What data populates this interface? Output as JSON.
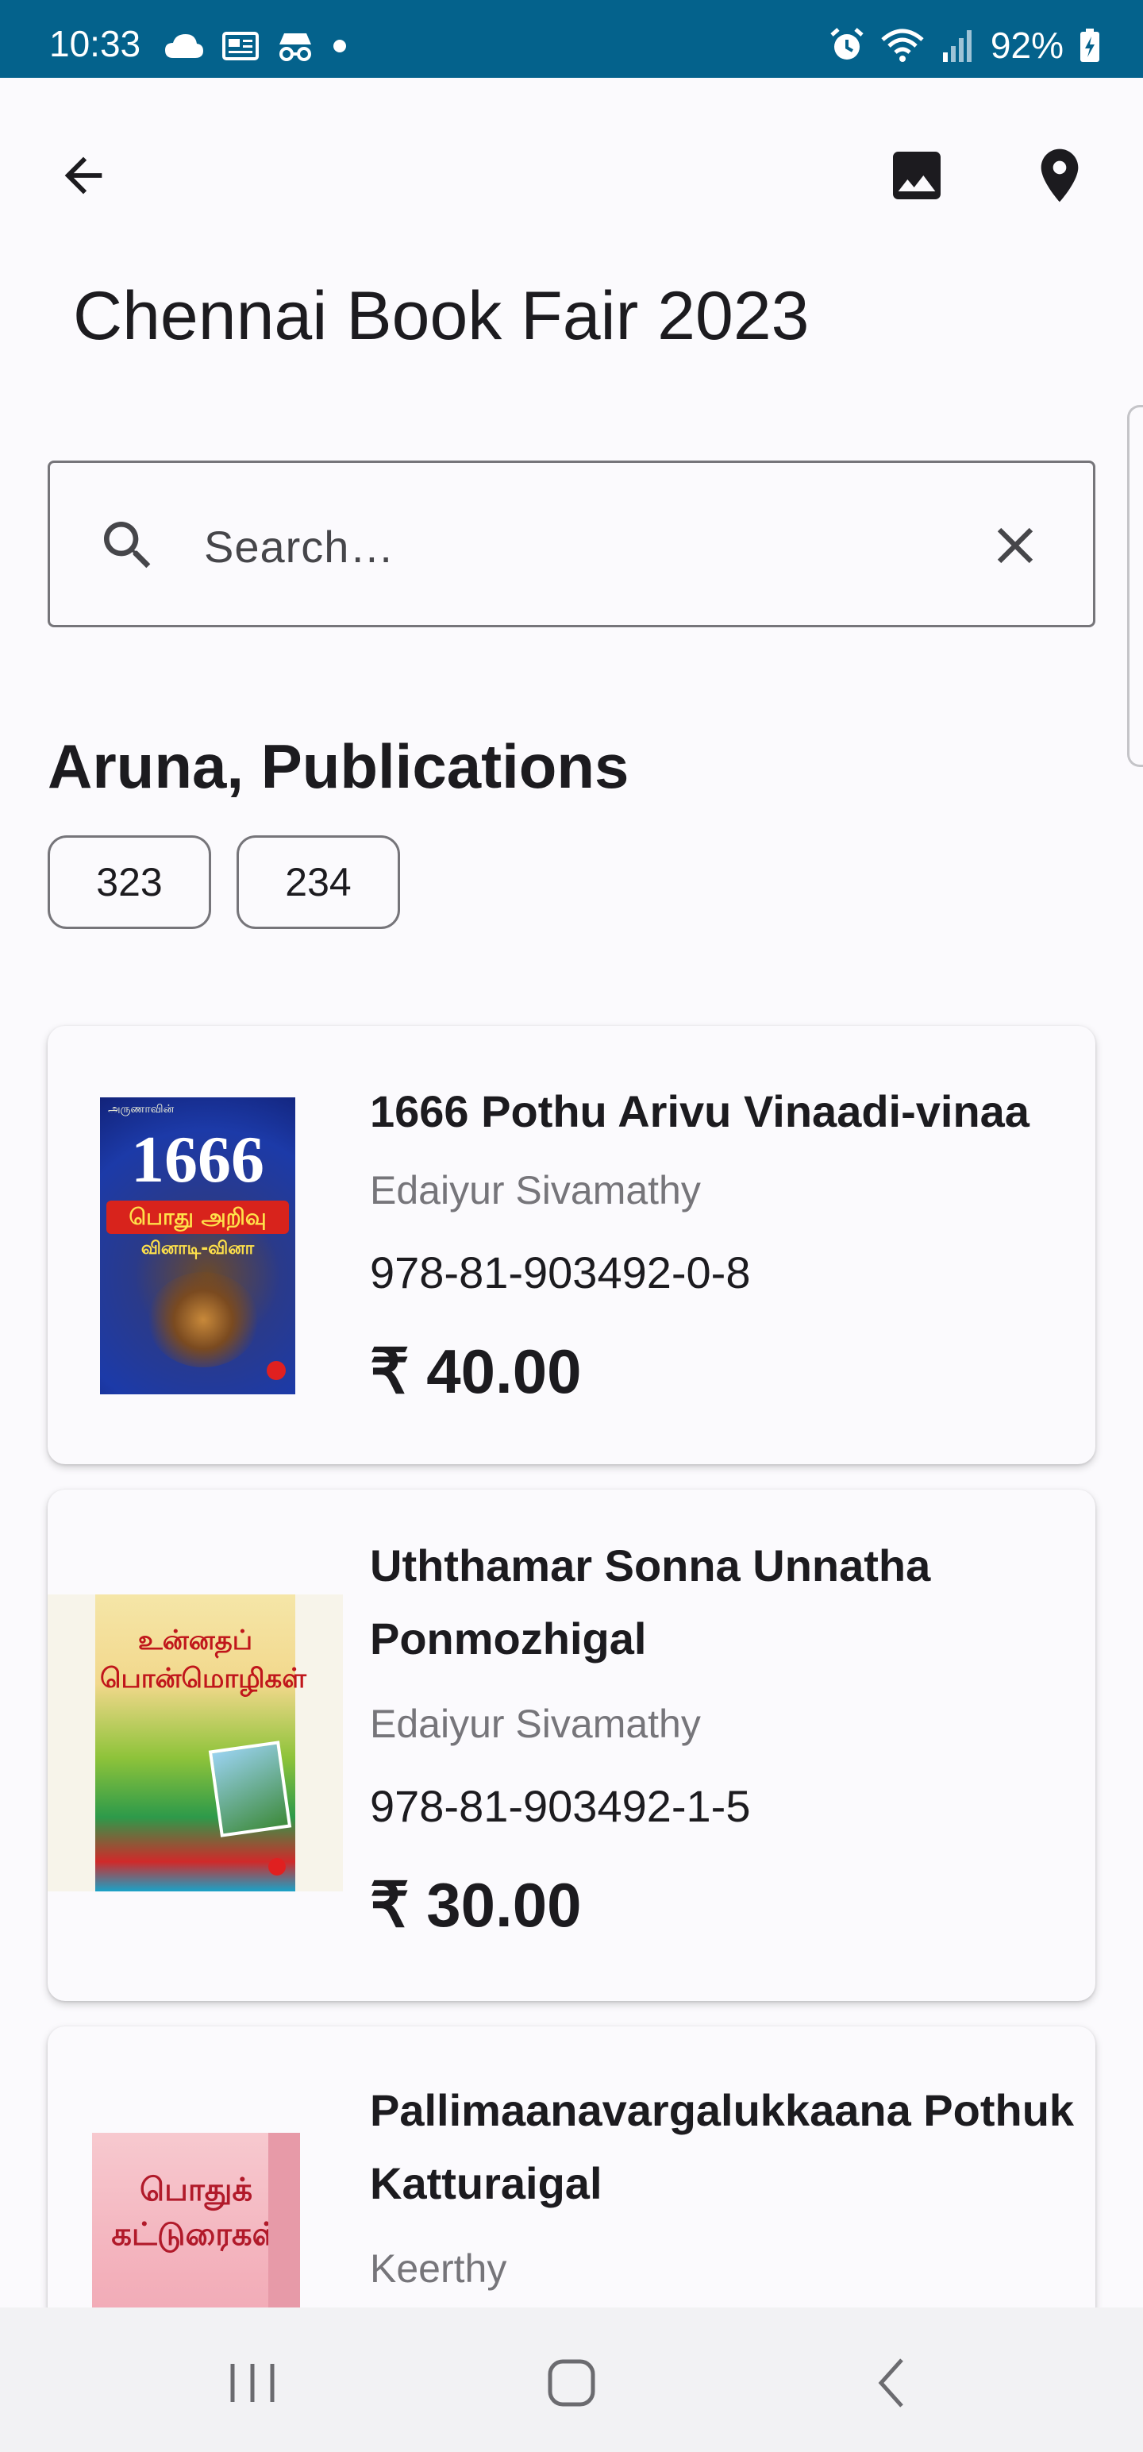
{
  "status_bar": {
    "time": "10:33",
    "battery": "92%",
    "left_icons": [
      "cloud-icon",
      "news-icon",
      "incognito-icon",
      "dot-icon"
    ],
    "right_icons": [
      "alarm-icon",
      "wifi-icon",
      "signal-icon",
      "battery-icon"
    ]
  },
  "toolbar": {
    "back_icon": "arrow-back-icon",
    "image_icon": "image-icon",
    "location_icon": "location-pin-icon"
  },
  "page": {
    "title": "Chennai Book Fair 2023"
  },
  "search": {
    "placeholder": "Search…",
    "value": ""
  },
  "publisher": {
    "name": "Aruna, Publications",
    "stalls": [
      "323",
      "234"
    ]
  },
  "books": [
    {
      "title": "1666 Pothu Arivu Vinaadi-vinaa",
      "author": "Edaiyur Sivamathy",
      "isbn": "978-81-903492-0-8",
      "price": "₹ 40.00",
      "cover_text_big": "1666",
      "cover_text_sub": "பொது அறிவு",
      "cover_text_sub2": "வினாடி-வினா"
    },
    {
      "title": "Uththamar Sonna Unnatha Ponmozhigal",
      "author": "Edaiyur Sivamathy",
      "isbn": "978-81-903492-1-5",
      "price": "₹ 30.00",
      "cover_text_big": "உன்னதப் பொன்மொழிகள்"
    },
    {
      "title": "Pallimaanavargalukkaana Pothuk Katturaigal",
      "author": "Keerthy",
      "cover_text_big": "பொதுக் கட்டுரைகள்"
    }
  ],
  "colors": {
    "status_bar": "#04628c",
    "background": "#fbfafd",
    "outline": "#76757a",
    "price_text": "#1c1b1f"
  }
}
